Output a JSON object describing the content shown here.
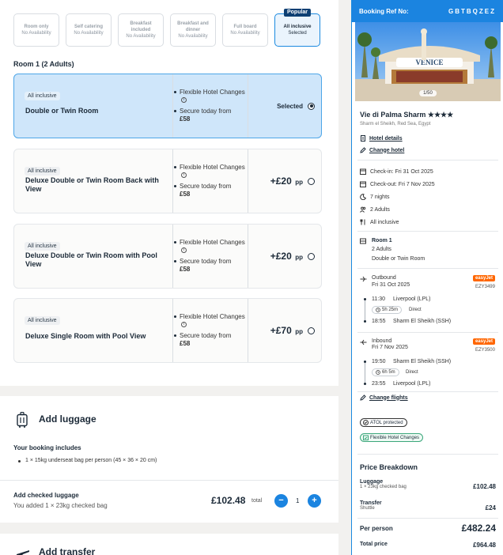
{
  "board_options": [
    {
      "name": "Room only",
      "status": "No Availability",
      "selected": false
    },
    {
      "name": "Self catering",
      "status": "No Availability",
      "selected": false
    },
    {
      "name": "Breakfast included",
      "status": "No Availability",
      "selected": false
    },
    {
      "name": "Breakfast and dinner",
      "status": "No Availability",
      "selected": false
    },
    {
      "name": "Full board",
      "status": "No Availability",
      "selected": false
    },
    {
      "name": "All inclusive",
      "status": "Selected",
      "selected": true,
      "badge": "Popular"
    }
  ],
  "room_heading": "Room 1 (2 Adults)",
  "rooms": [
    {
      "badge": "All inclusive",
      "name": "Double or Twin Room",
      "benefit": "Flexible Hotel Changes",
      "secure": "Secure today from",
      "deposit": "£58",
      "price": "Selected",
      "pp": "",
      "selected": true
    },
    {
      "badge": "All inclusive",
      "name": "Deluxe Double or Twin Room Back with View",
      "benefit": "Flexible Hotel Changes",
      "secure": "Secure today from",
      "deposit": "£58",
      "price": "+£20",
      "pp": "pp",
      "selected": false
    },
    {
      "badge": "All inclusive",
      "name": "Deluxe Double or Twin Room with Pool View",
      "benefit": "Flexible Hotel Changes",
      "secure": "Secure today from",
      "deposit": "£58",
      "price": "+£20",
      "pp": "pp",
      "selected": false
    },
    {
      "badge": "All inclusive",
      "name": "Deluxe Single Room with Pool View",
      "benefit": "Flexible Hotel Changes",
      "secure": "Secure today from",
      "deposit": "£58",
      "price": "+£70",
      "pp": "pp",
      "selected": false
    }
  ],
  "luggage": {
    "title": "Add luggage",
    "includes_label": "Your booking includes",
    "included_item": "1 × 15kg underseat bag per person (45 × 36 × 20 cm)",
    "add_title": "Add checked luggage",
    "add_sub": "You added 1 × 23kg checked bag",
    "price": "£102.48",
    "total_label": "total",
    "quantity": "1",
    "minus": "−",
    "plus": "+"
  },
  "transfer": {
    "title": "Add transfer"
  },
  "summary": {
    "ref_label": "Booking Ref No:",
    "ref": "GBTBQZEZ",
    "image_count": "1/50",
    "sign_text": "VENICE",
    "hotel_name": "Vie di Palma Sharm",
    "stars": "★★★★",
    "location": "Sharm el Sheikh, Red Sea, Egypt",
    "hotel_details": "Hotel details",
    "change_hotel": "Change hotel",
    "checkin": "Check-in: Fri 31 Oct 2025",
    "checkout": "Check-out: Fri 7 Nov 2025",
    "nights": "7 nights",
    "adults": "2 Adults",
    "board": "All inclusive",
    "room_title": "Room 1",
    "room_adults": "2 Adults",
    "room_type": "Double or Twin Room",
    "outbound": {
      "label": "Outbound",
      "date": "Fri 31 Oct 2025",
      "airline": "easyJet",
      "flight": "EZY3499",
      "dep_time": "11:30",
      "dep_airport": "Liverpool (LPL)",
      "duration": "5h 25m",
      "direct": "Direct",
      "arr_time": "18:55",
      "arr_airport": "Sharm El Sheikh (SSH)"
    },
    "inbound": {
      "label": "Inbound",
      "date": "Fri 7 Nov 2025",
      "airline": "easyJet",
      "flight": "EZY3500",
      "dep_time": "19:50",
      "dep_airport": "Sharm El Sheikh (SSH)",
      "duration": "6h 5m",
      "direct": "Direct",
      "arr_time": "23:55",
      "arr_airport": "Liverpool (LPL)"
    },
    "change_flights": "Change flights",
    "atol": "ATOL protected",
    "flex": "Flexible Hotel Changes",
    "price_breakdown": "Price Breakdown",
    "luggage_label": "Luggage",
    "luggage_sub": "1 × 23kg checked bag",
    "luggage_price": "£102.48",
    "transfer_label": "Transfer",
    "transfer_sub": "Shuttle",
    "transfer_price": "£24",
    "per_person_label": "Per person",
    "per_person_price": "£482.24",
    "total_label": "Total price",
    "total_price": "£964.48"
  },
  "colors": {
    "accent": "#1b84e0",
    "navy": "#0d3f73",
    "easyjet": "#ff6600",
    "selected_bg": "#cfe6fa"
  }
}
